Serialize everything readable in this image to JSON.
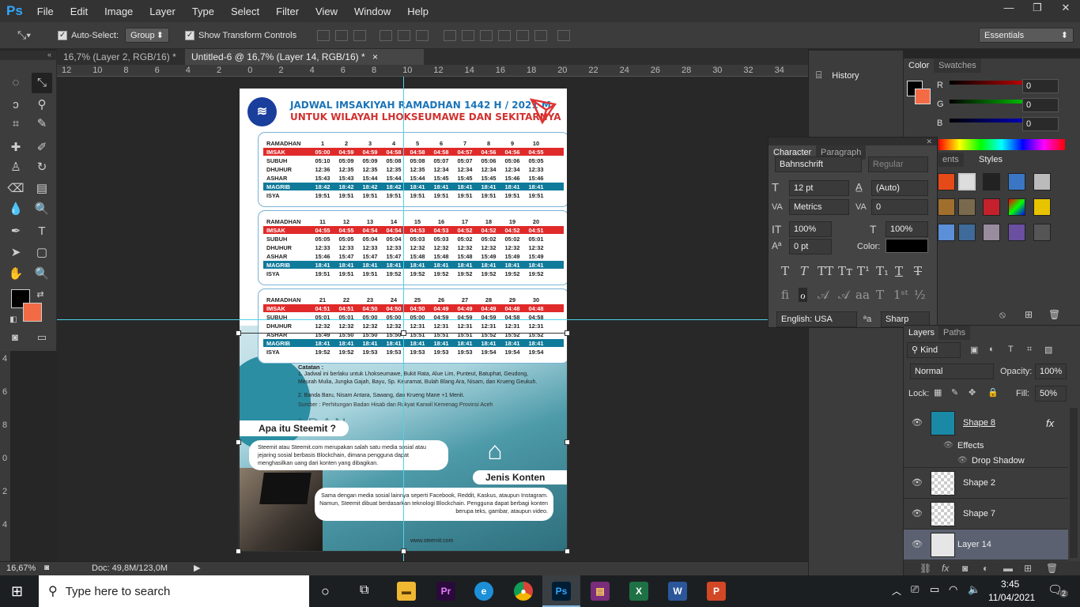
{
  "app": {
    "logo": "Ps",
    "brand_color": "#31a8ff"
  },
  "menu": [
    "File",
    "Edit",
    "Image",
    "Layer",
    "Type",
    "Select",
    "Filter",
    "View",
    "Window",
    "Help"
  ],
  "window_controls": {
    "minimize": "—",
    "restore": "❐",
    "close": "✕"
  },
  "options": {
    "auto_select_label": "Auto-Select:",
    "auto_select_value": "Group",
    "show_transform_label": "Show Transform Controls",
    "workspace": "Essentials"
  },
  "tabs": [
    {
      "label": "16,7% (Layer 2, RGB/16) *",
      "close": "×"
    },
    {
      "label": "Untitled-6 @ 16,7% (Layer 14, RGB/16) *",
      "close": "×"
    }
  ],
  "ruler": {
    "ticks": [
      "12",
      "10",
      "8",
      "6",
      "4",
      "2",
      "0",
      "2",
      "4",
      "6",
      "8",
      "10",
      "12",
      "14",
      "16",
      "18",
      "20",
      "22",
      "24",
      "26",
      "28",
      "30",
      "32",
      "34"
    ]
  },
  "left_ruler": [
    "4",
    "6",
    "8",
    "0",
    "2",
    "4"
  ],
  "document": {
    "title": "JADWAL IMSAKIYAH RAMADHAN 1442 H / 2021 M",
    "subtitle": "UNTUK WILAYAH LHOKSEUMAWE DAN SEKITARNYA",
    "tables": [
      {
        "days": [
          "1",
          "2",
          "3",
          "4",
          "5",
          "6",
          "7",
          "8",
          "9",
          "10"
        ],
        "rows": [
          {
            "label": "IMSAK",
            "style": "red",
            "values": [
              "05:00",
              "04:59",
              "04:59",
              "04:58",
              "04:58",
              "04:58",
              "04:57",
              "04:56",
              "04:56",
              "04:55"
            ]
          },
          {
            "label": "SUBUH",
            "style": "",
            "values": [
              "05:10",
              "05:09",
              "05:09",
              "05:08",
              "05:08",
              "05:07",
              "05:07",
              "05:06",
              "05:06",
              "05:05"
            ]
          },
          {
            "label": "DHUHUR",
            "style": "",
            "values": [
              "12:36",
              "12:35",
              "12:35",
              "12:35",
              "12:35",
              "12:34",
              "12:34",
              "12:34",
              "12:34",
              "12:33"
            ]
          },
          {
            "label": "ASHAR",
            "style": "",
            "values": [
              "15:43",
              "15:43",
              "15:44",
              "15:44",
              "15:44",
              "15:45",
              "15:45",
              "15:45",
              "15:46",
              "15:46"
            ]
          },
          {
            "label": "MAGRIB",
            "style": "teal",
            "values": [
              "18:42",
              "18:42",
              "18:42",
              "18:42",
              "18:41",
              "18:41",
              "18:41",
              "18:41",
              "18:41",
              "18:41"
            ]
          },
          {
            "label": "ISYA",
            "style": "",
            "values": [
              "19:51",
              "19:51",
              "19:51",
              "19:51",
              "19:51",
              "19:51",
              "19:51",
              "19:51",
              "19:51",
              "19:51"
            ]
          }
        ]
      },
      {
        "days": [
          "11",
          "12",
          "13",
          "14",
          "15",
          "16",
          "17",
          "18",
          "19",
          "20"
        ],
        "rows": [
          {
            "label": "IMSAK",
            "style": "red",
            "values": [
              "04:55",
              "04:55",
              "04:54",
              "04:54",
              "04:53",
              "04:53",
              "04:52",
              "04:52",
              "04:52",
              "04:51"
            ]
          },
          {
            "label": "SUBUH",
            "style": "",
            "values": [
              "05:05",
              "05:05",
              "05:04",
              "05:04",
              "05:03",
              "05:03",
              "05:02",
              "05:02",
              "05:02",
              "05:01"
            ]
          },
          {
            "label": "DHUHUR",
            "style": "",
            "values": [
              "12:33",
              "12:33",
              "12:33",
              "12:33",
              "12:32",
              "12:32",
              "12:32",
              "12:32",
              "12:32",
              "12:32"
            ]
          },
          {
            "label": "ASHAR",
            "style": "",
            "values": [
              "15:46",
              "15:47",
              "15:47",
              "15:47",
              "15:48",
              "15:48",
              "15:48",
              "15:49",
              "15:49",
              "15:49"
            ]
          },
          {
            "label": "MAGRIB",
            "style": "teal",
            "values": [
              "18:41",
              "18:41",
              "18:41",
              "18:41",
              "18:41",
              "18:41",
              "18:41",
              "18:41",
              "18:41",
              "18:41"
            ]
          },
          {
            "label": "ISYA",
            "style": "",
            "values": [
              "19:51",
              "19:51",
              "19:51",
              "19:52",
              "19:52",
              "19:52",
              "19:52",
              "19:52",
              "19:52",
              "19:52"
            ]
          }
        ]
      },
      {
        "days": [
          "21",
          "22",
          "23",
          "24",
          "25",
          "26",
          "27",
          "28",
          "29",
          "30"
        ],
        "rows": [
          {
            "label": "IMSAK",
            "style": "red",
            "values": [
              "04:51",
              "04:51",
              "04:50",
              "04:50",
              "04:50",
              "04:49",
              "04:49",
              "04:49",
              "04:48",
              "04:48"
            ]
          },
          {
            "label": "SUBUH",
            "style": "",
            "values": [
              "05:01",
              "05:01",
              "05:00",
              "05:00",
              "05:00",
              "04:59",
              "04:59",
              "04:59",
              "04:58",
              "04:58"
            ]
          },
          {
            "label": "DHUHUR",
            "style": "",
            "values": [
              "12:32",
              "12:32",
              "12:32",
              "12:32",
              "12:31",
              "12:31",
              "12:31",
              "12:31",
              "12:31",
              "12:31"
            ]
          },
          {
            "label": "ASHAR",
            "style": "",
            "values": [
              "15:49",
              "15:50",
              "15:50",
              "15:50",
              "15:51",
              "15:51",
              "15:51",
              "15:52",
              "15:52",
              "15:52"
            ]
          },
          {
            "label": "MAGRIB",
            "style": "teal",
            "values": [
              "18:41",
              "18:41",
              "18:41",
              "18:41",
              "18:41",
              "18:41",
              "18:41",
              "18:41",
              "18:41",
              "18:41"
            ]
          },
          {
            "label": "ISYA",
            "style": "",
            "values": [
              "19:52",
              "19:52",
              "19:53",
              "19:53",
              "19:53",
              "19:53",
              "19:53",
              "19:54",
              "19:54",
              "19:54"
            ]
          }
        ]
      }
    ],
    "header_label": "RAMADHAN",
    "notes_title": "Catatan :",
    "note1": "1. Jadwal ini berlaku untuk Lhokseumawe, Bukit Rata, Alue Lim, Punteut, Batuphat, Geudong, Meurah Mulia, Jungka Gajah, Bayu, Sp. Keuramat, Bulah Blang Ara, Nisam, dan Krueng Geukuh.",
    "note2": "2. Banda Baru, Nisam Antara, Sawang, dan Krueng Mane +1 Menit.",
    "source": "Sumber : Perhitungan Badan Hisab dan Rukyat Kanwil Kemenag Provinsi Aceh",
    "apa_title": "Apa itu Steemit ?",
    "apa_text": "Steemit atau Steemit.com merupakan salah satu media sosial atau jejaring sosial berbasis Blockchain, dimana pengguna dapat menghasilkan uang dari konten yang dibagikan.",
    "jenis_title": "Jenis Konten",
    "jenis_text": "Sama dengan media sosial lainnya seperti Facebook, Reddit, Kaskus, ataupun Instagram. Namun, Steemit dibuat berdasarkan teknologi Blockchain. Pengguna dapat berbagi konten berupa teks, gambar, ataupun video.",
    "footer_url": "www.steemit.com",
    "background_word": "ADAN"
  },
  "status": {
    "zoom": "16,67%",
    "doc": "Doc: 49,8M/123,0M"
  },
  "history": {
    "label": "History"
  },
  "color_panel": {
    "tabs": [
      "Color",
      "Swatches"
    ],
    "channels": [
      {
        "name": "R",
        "value": "0"
      },
      {
        "name": "G",
        "value": "0"
      },
      {
        "name": "B",
        "value": "0"
      }
    ]
  },
  "character": {
    "tabs": [
      "Character",
      "Paragraph"
    ],
    "font": "Bahnschrift",
    "style": "Regular",
    "size": "12 pt",
    "leading": "(Auto)",
    "kerning": "Metrics",
    "tracking": "0",
    "vscale": "100%",
    "hscale": "100%",
    "baseline": "0 pt",
    "color_label": "Color:",
    "language": "English: USA",
    "aa_label": "ªa",
    "antialias": "Sharp"
  },
  "styles_panel": {
    "tabs": [
      "ents",
      "Styles"
    ]
  },
  "layers": {
    "tabs": [
      "Layers",
      "Paths"
    ],
    "kind": "Kind",
    "blend": "Normal",
    "opacity_label": "Opacity:",
    "opacity": "100%",
    "lock_label": "Lock:",
    "fill_label": "Fill:",
    "fill": "50%",
    "items": [
      {
        "name": "Shape 8",
        "fx": "fx"
      },
      {
        "name": "Shape 2"
      },
      {
        "name": "Shape 7"
      },
      {
        "name": "Layer 14"
      }
    ],
    "effects_label": "Effects",
    "drop_shadow": "Drop Shadow"
  },
  "taskbar": {
    "search_placeholder": "Type here to search",
    "time": "3:45",
    "date": "11/04/2021",
    "notif_count": "2"
  }
}
